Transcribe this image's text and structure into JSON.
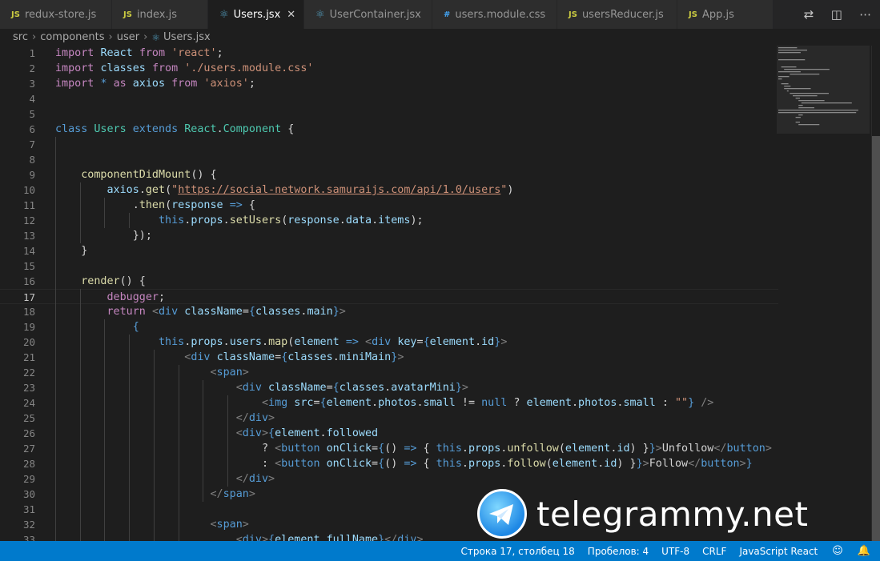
{
  "tabs": [
    {
      "label": "redux-store.js",
      "icon": "js-file-icon",
      "glyph": "JS",
      "kind": "js",
      "active": false,
      "width": 140
    },
    {
      "label": "index.js",
      "icon": "js-file-icon",
      "glyph": "JS",
      "kind": "js",
      "active": false,
      "width": 120
    },
    {
      "label": "Users.jsx",
      "icon": "react-file-icon",
      "glyph": "⚛",
      "kind": "react",
      "active": true,
      "width": 120
    },
    {
      "label": "UserContainer.jsx",
      "icon": "react-file-icon",
      "glyph": "⚛",
      "kind": "react",
      "active": false,
      "width": 160
    },
    {
      "label": "users.module.css",
      "icon": "css-file-icon",
      "glyph": "#",
      "kind": "css",
      "active": false,
      "width": 156
    },
    {
      "label": "usersReducer.js",
      "icon": "js-file-icon",
      "glyph": "JS",
      "kind": "js",
      "active": false,
      "width": 150
    },
    {
      "label": "App.js",
      "icon": "js-file-icon",
      "glyph": "JS",
      "kind": "js",
      "active": false,
      "width": 120
    }
  ],
  "breadcrumb": {
    "parts": [
      "src",
      "components",
      "user"
    ],
    "file": "Users.jsx"
  },
  "editor": {
    "current_line": 17,
    "lines": [
      {
        "n": 1,
        "tokens": [
          [
            "k",
            "import"
          ],
          [
            "p",
            " "
          ],
          [
            "v",
            "React"
          ],
          [
            "p",
            " "
          ],
          [
            "k",
            "from"
          ],
          [
            "p",
            " "
          ],
          [
            "s",
            "'react'"
          ],
          [
            "p",
            ";"
          ]
        ]
      },
      {
        "n": 2,
        "tokens": [
          [
            "k",
            "import"
          ],
          [
            "p",
            " "
          ],
          [
            "v",
            "classes"
          ],
          [
            "p",
            " "
          ],
          [
            "k",
            "from"
          ],
          [
            "p",
            " "
          ],
          [
            "s",
            "'./users.module.css'"
          ]
        ]
      },
      {
        "n": 3,
        "tokens": [
          [
            "k",
            "import"
          ],
          [
            "p",
            " "
          ],
          [
            "kb",
            "*"
          ],
          [
            "p",
            " "
          ],
          [
            "k",
            "as"
          ],
          [
            "p",
            " "
          ],
          [
            "v",
            "axios"
          ],
          [
            "p",
            " "
          ],
          [
            "k",
            "from"
          ],
          [
            "p",
            " "
          ],
          [
            "s",
            "'axios'"
          ],
          [
            "p",
            ";"
          ]
        ]
      },
      {
        "n": 4,
        "tokens": []
      },
      {
        "n": 5,
        "tokens": []
      },
      {
        "n": 6,
        "tokens": [
          [
            "kb",
            "class"
          ],
          [
            "p",
            " "
          ],
          [
            "c",
            "Users"
          ],
          [
            "p",
            " "
          ],
          [
            "kb",
            "extends"
          ],
          [
            "p",
            " "
          ],
          [
            "c",
            "React"
          ],
          [
            "p",
            "."
          ],
          [
            "c",
            "Component"
          ],
          [
            "p",
            " {"
          ]
        ]
      },
      {
        "n": 7,
        "tokens": []
      },
      {
        "n": 8,
        "tokens": []
      },
      {
        "n": 9,
        "tokens": [
          [
            "p",
            "    "
          ],
          [
            "f",
            "componentDidMount"
          ],
          [
            "p",
            "() {"
          ]
        ]
      },
      {
        "n": 10,
        "tokens": [
          [
            "p",
            "        "
          ],
          [
            "v",
            "axios"
          ],
          [
            "p",
            "."
          ],
          [
            "f",
            "get"
          ],
          [
            "p",
            "("
          ],
          [
            "s",
            "\""
          ],
          [
            "sl",
            "https://social-network.samuraijs.com/api/1.0/users"
          ],
          [
            "s",
            "\""
          ],
          [
            "p",
            ")"
          ]
        ]
      },
      {
        "n": 11,
        "tokens": [
          [
            "p",
            "            ."
          ],
          [
            "f",
            "then"
          ],
          [
            "p",
            "("
          ],
          [
            "v",
            "response"
          ],
          [
            "p",
            " "
          ],
          [
            "kb",
            "=>"
          ],
          [
            "p",
            " {"
          ]
        ]
      },
      {
        "n": 12,
        "tokens": [
          [
            "p",
            "                "
          ],
          [
            "kb",
            "this"
          ],
          [
            "p",
            "."
          ],
          [
            "v",
            "props"
          ],
          [
            "p",
            "."
          ],
          [
            "f",
            "setUsers"
          ],
          [
            "p",
            "("
          ],
          [
            "v",
            "response"
          ],
          [
            "p",
            "."
          ],
          [
            "v",
            "data"
          ],
          [
            "p",
            "."
          ],
          [
            "v",
            "items"
          ],
          [
            "p",
            ");"
          ]
        ]
      },
      {
        "n": 13,
        "tokens": [
          [
            "p",
            "            });"
          ]
        ]
      },
      {
        "n": 14,
        "tokens": [
          [
            "p",
            "    }"
          ]
        ]
      },
      {
        "n": 15,
        "tokens": []
      },
      {
        "n": 16,
        "tokens": [
          [
            "p",
            "    "
          ],
          [
            "f",
            "render"
          ],
          [
            "p",
            "() {"
          ]
        ]
      },
      {
        "n": 17,
        "tokens": [
          [
            "p",
            "        "
          ],
          [
            "k",
            "debugger"
          ],
          [
            "p",
            ";"
          ]
        ]
      },
      {
        "n": 18,
        "tokens": [
          [
            "p",
            "        "
          ],
          [
            "k",
            "return"
          ],
          [
            "p",
            " "
          ],
          [
            "t",
            "<"
          ],
          [
            "tag",
            "div"
          ],
          [
            "p",
            " "
          ],
          [
            "v",
            "className"
          ],
          [
            "p",
            "="
          ],
          [
            "kb",
            "{"
          ],
          [
            "v",
            "classes"
          ],
          [
            "p",
            "."
          ],
          [
            "v",
            "main"
          ],
          [
            "kb",
            "}"
          ],
          [
            "t",
            ">"
          ]
        ]
      },
      {
        "n": 19,
        "tokens": [
          [
            "p",
            "            "
          ],
          [
            "kb",
            "{"
          ]
        ]
      },
      {
        "n": 20,
        "tokens": [
          [
            "p",
            "                "
          ],
          [
            "kb",
            "this"
          ],
          [
            "p",
            "."
          ],
          [
            "v",
            "props"
          ],
          [
            "p",
            "."
          ],
          [
            "v",
            "users"
          ],
          [
            "p",
            "."
          ],
          [
            "f",
            "map"
          ],
          [
            "p",
            "("
          ],
          [
            "v",
            "element"
          ],
          [
            "p",
            " "
          ],
          [
            "kb",
            "=>"
          ],
          [
            "p",
            " "
          ],
          [
            "t",
            "<"
          ],
          [
            "tag",
            "div"
          ],
          [
            "p",
            " "
          ],
          [
            "v",
            "key"
          ],
          [
            "p",
            "="
          ],
          [
            "kb",
            "{"
          ],
          [
            "v",
            "element"
          ],
          [
            "p",
            "."
          ],
          [
            "v",
            "id"
          ],
          [
            "kb",
            "}"
          ],
          [
            "t",
            ">"
          ]
        ]
      },
      {
        "n": 21,
        "tokens": [
          [
            "p",
            "                    "
          ],
          [
            "t",
            "<"
          ],
          [
            "tag",
            "div"
          ],
          [
            "p",
            " "
          ],
          [
            "v",
            "className"
          ],
          [
            "p",
            "="
          ],
          [
            "kb",
            "{"
          ],
          [
            "v",
            "classes"
          ],
          [
            "p",
            "."
          ],
          [
            "v",
            "miniMain"
          ],
          [
            "kb",
            "}"
          ],
          [
            "t",
            ">"
          ]
        ]
      },
      {
        "n": 22,
        "tokens": [
          [
            "p",
            "                        "
          ],
          [
            "t",
            "<"
          ],
          [
            "tag",
            "span"
          ],
          [
            "t",
            ">"
          ]
        ]
      },
      {
        "n": 23,
        "tokens": [
          [
            "p",
            "                            "
          ],
          [
            "t",
            "<"
          ],
          [
            "tag",
            "div"
          ],
          [
            "p",
            " "
          ],
          [
            "v",
            "className"
          ],
          [
            "p",
            "="
          ],
          [
            "kb",
            "{"
          ],
          [
            "v",
            "classes"
          ],
          [
            "p",
            "."
          ],
          [
            "v",
            "avatarMini"
          ],
          [
            "kb",
            "}"
          ],
          [
            "t",
            ">"
          ]
        ]
      },
      {
        "n": 24,
        "tokens": [
          [
            "p",
            "                                "
          ],
          [
            "t",
            "<"
          ],
          [
            "tag",
            "img"
          ],
          [
            "p",
            " "
          ],
          [
            "v",
            "src"
          ],
          [
            "p",
            "="
          ],
          [
            "kb",
            "{"
          ],
          [
            "v",
            "element"
          ],
          [
            "p",
            "."
          ],
          [
            "v",
            "photos"
          ],
          [
            "p",
            "."
          ],
          [
            "v",
            "small"
          ],
          [
            "p",
            " != "
          ],
          [
            "kb",
            "null"
          ],
          [
            "p",
            " ? "
          ],
          [
            "v",
            "element"
          ],
          [
            "p",
            "."
          ],
          [
            "v",
            "photos"
          ],
          [
            "p",
            "."
          ],
          [
            "v",
            "small"
          ],
          [
            "p",
            " : "
          ],
          [
            "s",
            "\"\""
          ],
          [
            "kb",
            "}"
          ],
          [
            "p",
            " "
          ],
          [
            "t",
            "/>"
          ]
        ]
      },
      {
        "n": 25,
        "tokens": [
          [
            "p",
            "                            "
          ],
          [
            "t",
            "</"
          ],
          [
            "tag",
            "div"
          ],
          [
            "t",
            ">"
          ]
        ]
      },
      {
        "n": 26,
        "tokens": [
          [
            "p",
            "                            "
          ],
          [
            "t",
            "<"
          ],
          [
            "tag",
            "div"
          ],
          [
            "t",
            ">"
          ],
          [
            "kb",
            "{"
          ],
          [
            "v",
            "element"
          ],
          [
            "p",
            "."
          ],
          [
            "v",
            "followed"
          ]
        ]
      },
      {
        "n": 27,
        "tokens": [
          [
            "p",
            "                                ? "
          ],
          [
            "t",
            "<"
          ],
          [
            "tag",
            "button"
          ],
          [
            "p",
            " "
          ],
          [
            "v",
            "onClick"
          ],
          [
            "p",
            "="
          ],
          [
            "kb",
            "{"
          ],
          [
            "p",
            "() "
          ],
          [
            "kb",
            "=>"
          ],
          [
            "p",
            " { "
          ],
          [
            "kb",
            "this"
          ],
          [
            "p",
            "."
          ],
          [
            "v",
            "props"
          ],
          [
            "p",
            "."
          ],
          [
            "f",
            "unfollow"
          ],
          [
            "p",
            "("
          ],
          [
            "v",
            "element"
          ],
          [
            "p",
            "."
          ],
          [
            "v",
            "id"
          ],
          [
            "p",
            ") }"
          ],
          [
            "kb",
            "}"
          ],
          [
            "t",
            ">"
          ],
          [
            "p",
            "Unfollow"
          ],
          [
            "t",
            "</"
          ],
          [
            "tag",
            "button"
          ],
          [
            "t",
            ">"
          ]
        ]
      },
      {
        "n": 28,
        "tokens": [
          [
            "p",
            "                                : "
          ],
          [
            "t",
            "<"
          ],
          [
            "tag",
            "button"
          ],
          [
            "p",
            " "
          ],
          [
            "v",
            "onClick"
          ],
          [
            "p",
            "="
          ],
          [
            "kb",
            "{"
          ],
          [
            "p",
            "() "
          ],
          [
            "kb",
            "=>"
          ],
          [
            "p",
            " { "
          ],
          [
            "kb",
            "this"
          ],
          [
            "p",
            "."
          ],
          [
            "v",
            "props"
          ],
          [
            "p",
            "."
          ],
          [
            "f",
            "follow"
          ],
          [
            "p",
            "("
          ],
          [
            "v",
            "element"
          ],
          [
            "p",
            "."
          ],
          [
            "v",
            "id"
          ],
          [
            "p",
            ") }"
          ],
          [
            "kb",
            "}"
          ],
          [
            "t",
            ">"
          ],
          [
            "p",
            "Follow"
          ],
          [
            "t",
            "</"
          ],
          [
            "tag",
            "button"
          ],
          [
            "t",
            ">"
          ],
          [
            "kb",
            "}"
          ]
        ]
      },
      {
        "n": 29,
        "tokens": [
          [
            "p",
            "                            "
          ],
          [
            "t",
            "</"
          ],
          [
            "tag",
            "div"
          ],
          [
            "t",
            ">"
          ]
        ]
      },
      {
        "n": 30,
        "tokens": [
          [
            "p",
            "                        "
          ],
          [
            "t",
            "</"
          ],
          [
            "tag",
            "span"
          ],
          [
            "t",
            ">"
          ]
        ]
      },
      {
        "n": 31,
        "tokens": []
      },
      {
        "n": 32,
        "tokens": [
          [
            "p",
            "                        "
          ],
          [
            "t",
            "<"
          ],
          [
            "tag",
            "span"
          ],
          [
            "t",
            ">"
          ]
        ]
      },
      {
        "n": 33,
        "tokens": [
          [
            "p",
            "                            "
          ],
          [
            "t",
            "<"
          ],
          [
            "tag",
            "div"
          ],
          [
            "t",
            ">"
          ],
          [
            "kb",
            "{"
          ],
          [
            "v",
            "element"
          ],
          [
            "p",
            "."
          ],
          [
            "v",
            "fullName"
          ],
          [
            "kb",
            "}"
          ],
          [
            "t",
            "</"
          ],
          [
            "tag",
            "div"
          ],
          [
            "t",
            ">"
          ]
        ]
      }
    ]
  },
  "statusbar": {
    "position": "Строка 17, столбец 18",
    "spaces": "Пробелов: 4",
    "encoding": "UTF-8",
    "eol": "CRLF",
    "language": "JavaScript React"
  },
  "watermark": {
    "text": "telegrammy.net"
  },
  "colors": {
    "statusbar": "#007acc",
    "editor_bg": "#1e1e1e",
    "tab_bg": "#2d2d2d"
  }
}
